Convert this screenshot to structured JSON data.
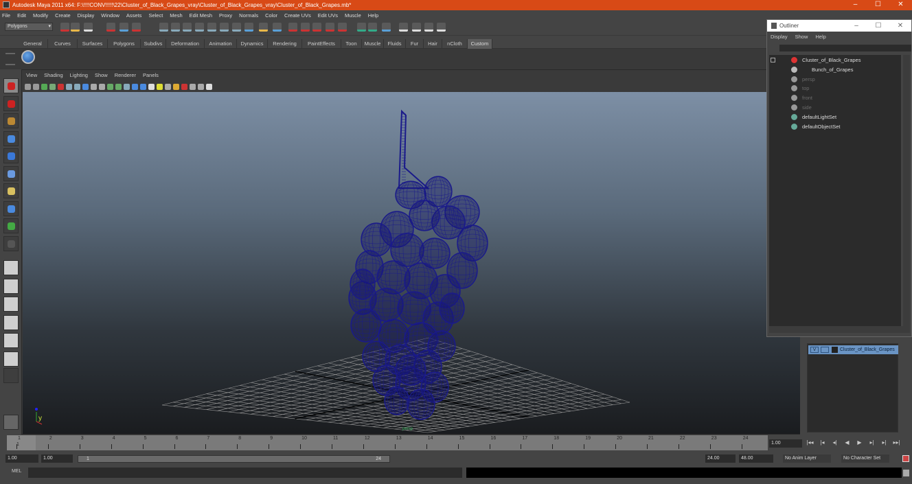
{
  "window": {
    "title": "Autodesk Maya 2011 x64: F:\\!!!!CONV!!!!!\\22\\Cluster_of_Black_Grapes_vray\\Cluster_of_Black_Grapes_vray\\Cluster_of_Black_Grapes.mb*",
    "buttons": [
      "–",
      "☐",
      "✕"
    ]
  },
  "menubar": [
    "File",
    "Edit",
    "Modify",
    "Create",
    "Display",
    "Window",
    "Assets",
    "Select",
    "Mesh",
    "Edit Mesh",
    "Proxy",
    "Normals",
    "Color",
    "Create UVs",
    "Edit UVs",
    "Muscle",
    "Help"
  ],
  "status_line": {
    "mode": "Polygons"
  },
  "shelf": {
    "tabs": [
      "General",
      "Curves",
      "Surfaces",
      "Polygons",
      "Subdivs",
      "Deformation",
      "Animation",
      "Dynamics",
      "Rendering",
      "PaintEffects",
      "Toon",
      "Muscle",
      "Fluids",
      "Fur",
      "Hair",
      "nCloth",
      "Custom"
    ],
    "active_tab": "Custom"
  },
  "toolbox": [
    "select-tool",
    "lasso-tool",
    "paint-select-tool",
    "move-tool",
    "rotate-tool",
    "scale-tool",
    "universal-manipulator",
    "soft-mod-tool",
    "show-manipulator",
    "last-tool"
  ],
  "layouts": [
    "single-perspective",
    "four-view",
    "persp-outliner",
    "persp-graph",
    "hypershade-persp",
    "persp-graph-hypergraph"
  ],
  "viewport": {
    "menu": [
      "View",
      "Shading",
      "Lighting",
      "Show",
      "Renderer",
      "Panels"
    ],
    "camera_label": "persp",
    "axis_label": "y",
    "wire_color": "#1a1a8a"
  },
  "outliner": {
    "title": "Outliner",
    "menu": [
      "Display",
      "Show",
      "Help"
    ],
    "nodes": [
      {
        "label": "Cluster_of_Black_Grapes",
        "indent": 0,
        "dim": false,
        "icon": "group-icon"
      },
      {
        "label": "Bunch_of_Grapes",
        "indent": 1,
        "dim": false,
        "icon": "mesh-icon"
      },
      {
        "label": "persp",
        "indent": 0,
        "dim": true,
        "icon": "camera-icon"
      },
      {
        "label": "top",
        "indent": 0,
        "dim": true,
        "icon": "camera-icon"
      },
      {
        "label": "front",
        "indent": 0,
        "dim": true,
        "icon": "camera-icon"
      },
      {
        "label": "side",
        "indent": 0,
        "dim": true,
        "icon": "camera-icon"
      },
      {
        "label": "defaultLightSet",
        "indent": 0,
        "dim": false,
        "icon": "set-icon"
      },
      {
        "label": "defaultObjectSet",
        "indent": 0,
        "dim": false,
        "icon": "set-icon"
      }
    ]
  },
  "layers": {
    "rows": [
      {
        "visible": "V",
        "name": "Cluster_of_Black_Grapes"
      }
    ]
  },
  "timeline": {
    "ticks": [
      "1",
      "2",
      "3",
      "4",
      "5",
      "6",
      "7",
      "8",
      "9",
      "10",
      "11",
      "12",
      "13",
      "14",
      "15",
      "16",
      "17",
      "18",
      "19",
      "20",
      "21",
      "22",
      "23",
      "24"
    ],
    "current_frame": "1",
    "current_time_field": "1.00",
    "start_time": "1.00",
    "playback_start": "1.00",
    "range_start_label": "1",
    "range_end_label": "24",
    "playback_end": "24.00",
    "end_time": "48.00",
    "anim_layer": "No Anim Layer",
    "character_set": "No Character Set"
  },
  "command_line": {
    "label": "MEL",
    "input": "",
    "output": ""
  }
}
